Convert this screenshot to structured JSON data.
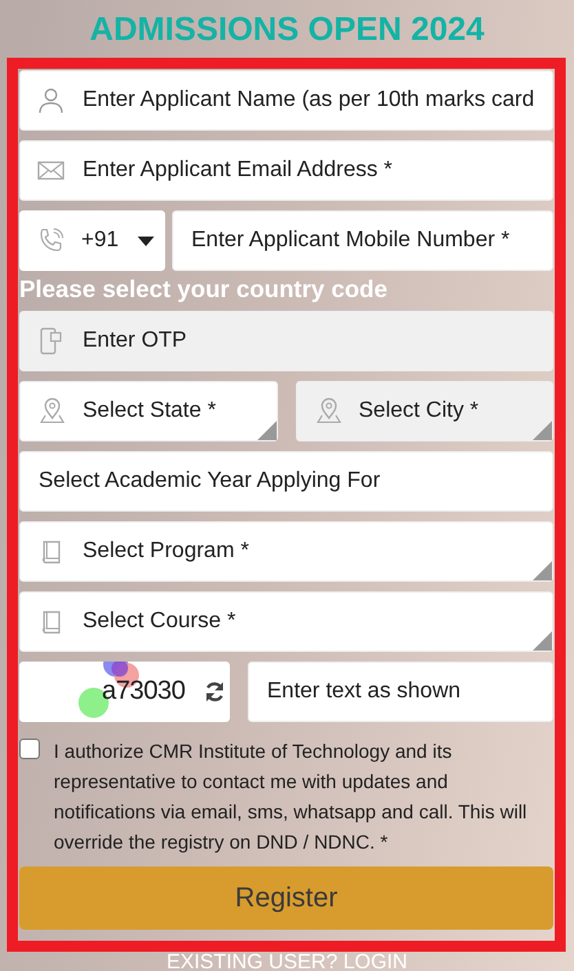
{
  "title": "ADMISSIONS OPEN 2024",
  "form": {
    "name": {
      "placeholder": "Enter Applicant Name (as per 10th marks card"
    },
    "email": {
      "placeholder": "Enter Applicant Email Address *"
    },
    "phone": {
      "country_code": "+91",
      "placeholder": "Enter Applicant Mobile Number *",
      "hint": "Please select your country code"
    },
    "otp": {
      "placeholder": "Enter OTP",
      "disabled": true
    },
    "location": [
      {
        "label": "Select State *",
        "disabled": false
      },
      {
        "label": "Select City *",
        "disabled": true
      }
    ],
    "selects": [
      {
        "kind": "plain",
        "label": "Select Academic Year Applying For"
      },
      {
        "kind": "book",
        "label": "Select Program *"
      },
      {
        "kind": "book",
        "label": "Select Course *"
      }
    ],
    "captcha": {
      "code": "a73030",
      "placeholder": "Enter text as shown"
    },
    "consent": {
      "checked": false,
      "text": "I authorize CMR Institute of Technology and its representative to contact me with updates and notifications via email, sms, whatsapp and call. This will override the registry on DND / NDNC. *"
    },
    "submit": "Register"
  },
  "footer_link": "EXISTING USER? LOGIN"
}
